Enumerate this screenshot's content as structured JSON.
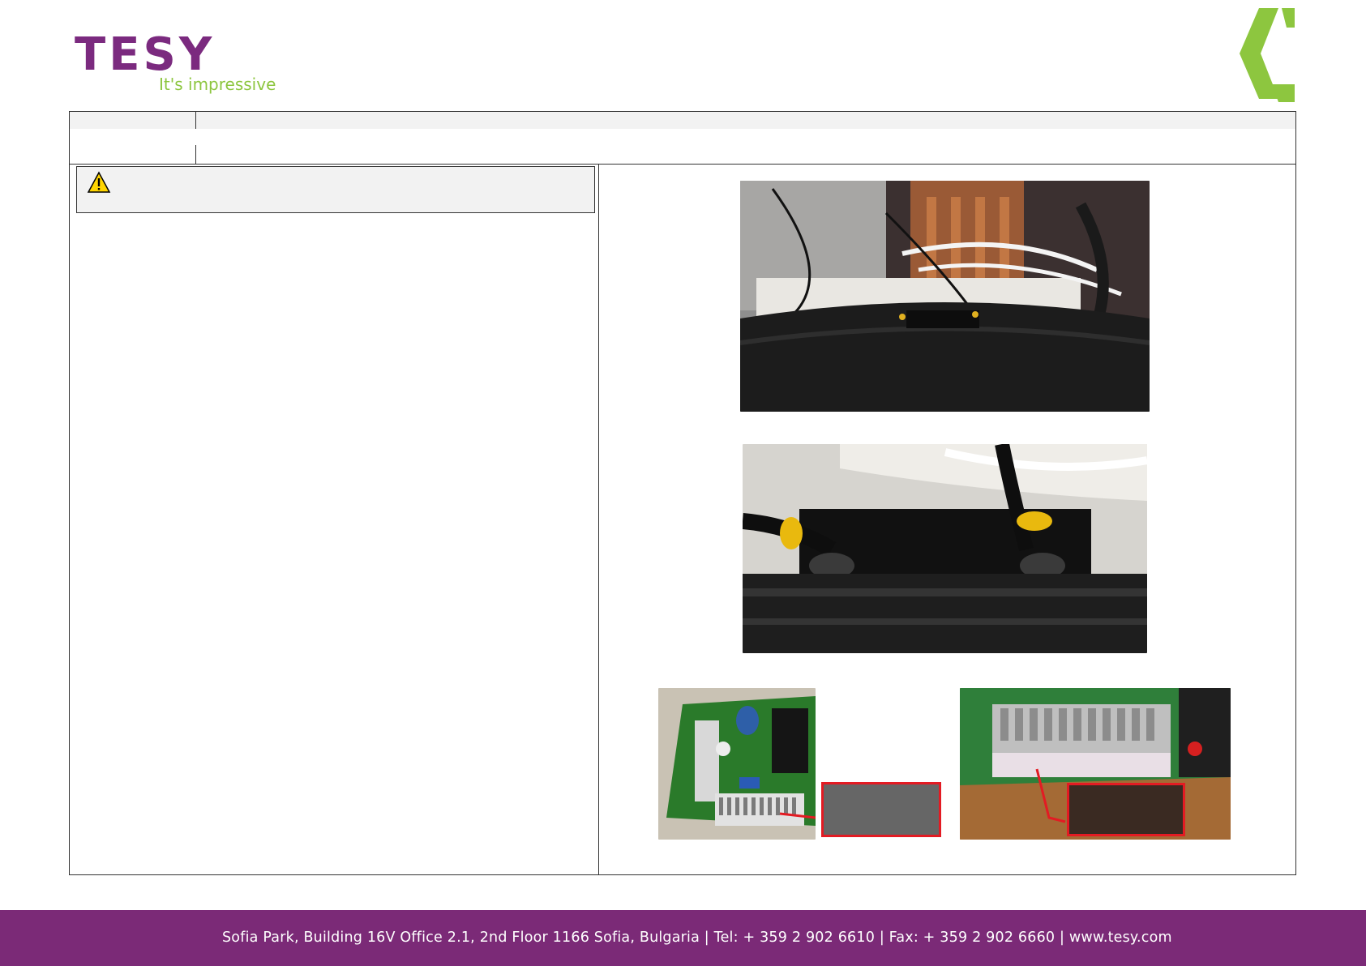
{
  "brand": {
    "name": "TESY",
    "tagline": "It's impressive",
    "primary_color": "#7b2a7f",
    "accent_color": "#8dc63f"
  },
  "warning": {
    "icon": "warning-triangle-icon"
  },
  "photos": [
    {
      "id": "tank-base-wiring"
    },
    {
      "id": "sensor-cable-closeup"
    },
    {
      "id": "control-board"
    },
    {
      "id": "terminal-block-closeup"
    }
  ],
  "footer": {
    "background": "#7b2a77",
    "text": "Sofia Park, Building 16V Office 2.1, 2nd Floor 1166 Sofia, Bulgaria  |  Tel: + 359 2 902 6610  |  Fax: + 359 2 902 6660  |  www.tesy.com"
  }
}
